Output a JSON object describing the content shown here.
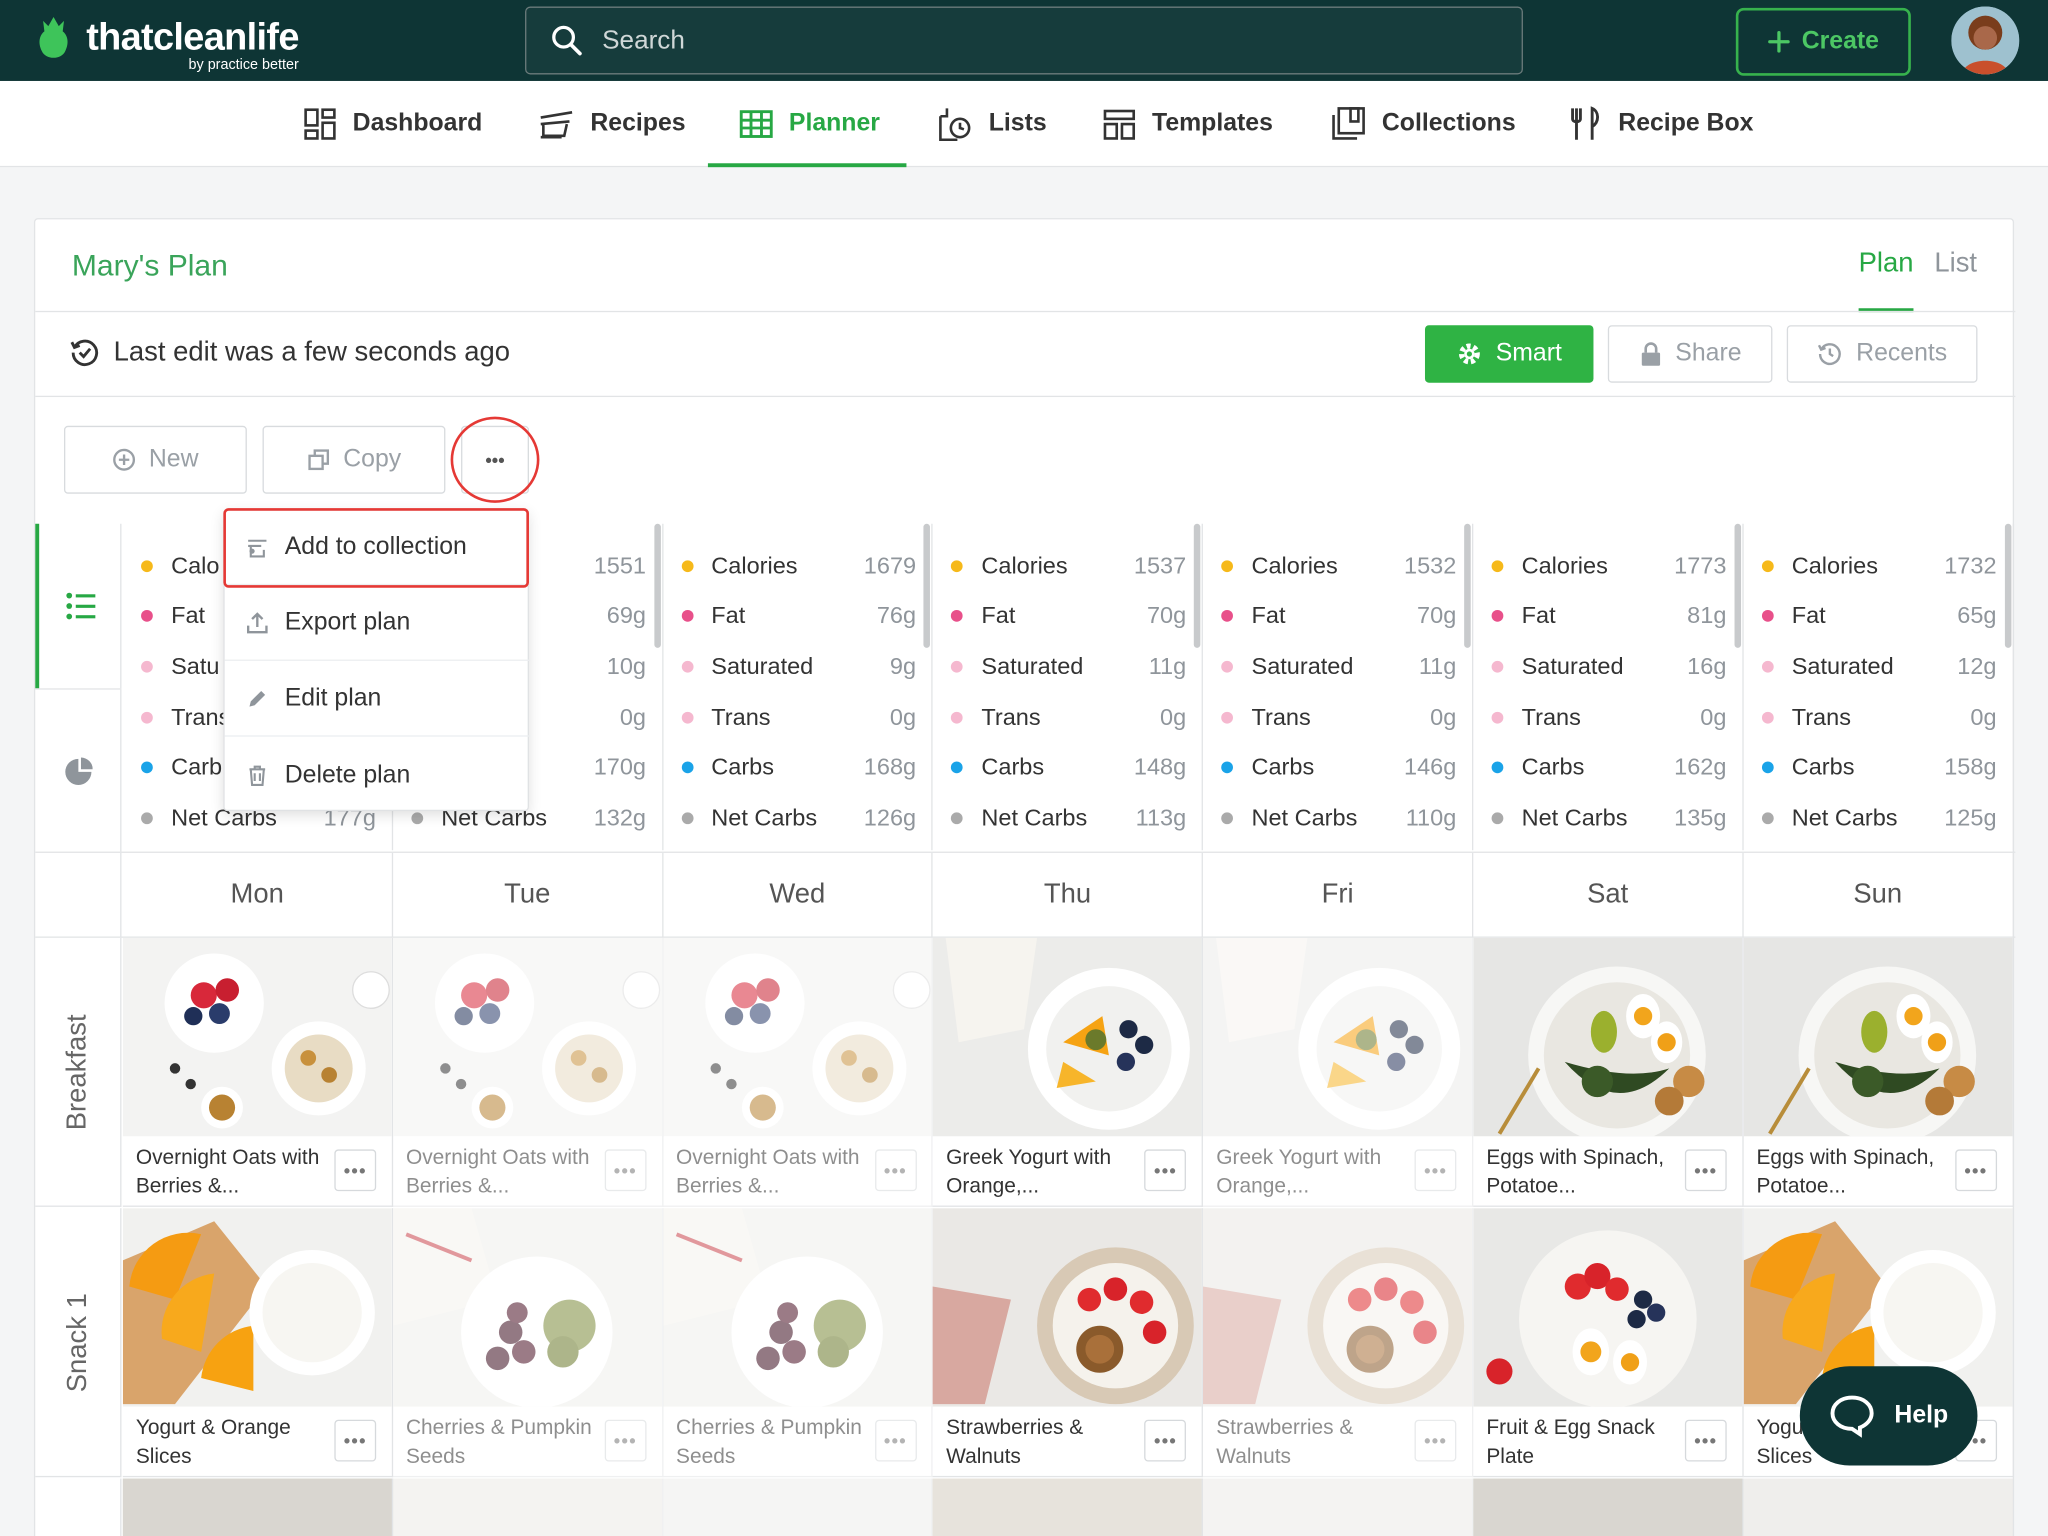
{
  "brand": {
    "name": "thatcleanlife",
    "sub": "by practice better"
  },
  "search": {
    "placeholder": "Search"
  },
  "create_label": "Create",
  "nav": [
    {
      "label": "Dashboard",
      "icon": "dashboard-icon"
    },
    {
      "label": "Recipes",
      "icon": "recipes-icon"
    },
    {
      "label": "Planner",
      "icon": "planner-icon",
      "active": true
    },
    {
      "label": "Lists",
      "icon": "lists-icon"
    },
    {
      "label": "Templates",
      "icon": "templates-icon"
    },
    {
      "label": "Collections",
      "icon": "collections-icon"
    },
    {
      "label": "Recipe Box",
      "icon": "recipe-box-icon"
    }
  ],
  "plan": {
    "title": "Mary's Plan",
    "tab_plan": "Plan",
    "tab_list": "List",
    "last_edit": "Last edit was a few seconds ago"
  },
  "actions": {
    "smart": "Smart",
    "share": "Share",
    "recents": "Recents",
    "new": "New",
    "copy": "Copy",
    "more": "•••"
  },
  "menu": [
    {
      "label": "Add to collection",
      "icon": "collection-add-icon"
    },
    {
      "label": "Export plan",
      "icon": "export-icon"
    },
    {
      "label": "Edit plan",
      "icon": "pencil-icon"
    },
    {
      "label": "Delete plan",
      "icon": "trash-icon"
    }
  ],
  "nutrient_names": [
    "Calories",
    "Fat",
    "Saturated",
    "Trans",
    "Carbs",
    "Net Carbs"
  ],
  "nutrient_colors": [
    "#f6b91a",
    "#e8508a",
    "#f5b8cf",
    "#f5b8cf",
    "#1aa3e8",
    "#aaaaaa"
  ],
  "nutrition": [
    {
      "day": "Mon",
      "values": [
        "",
        "",
        "",
        "",
        "",
        "177g"
      ],
      "labels": [
        "Calo",
        "Fat",
        "Satu",
        "Trans",
        "Carb",
        "Net Carbs"
      ]
    },
    {
      "day": "Tue",
      "values": [
        "1551",
        "69g",
        "10g",
        "0g",
        "170g",
        "132g"
      ],
      "labels": [
        "",
        "",
        "ed",
        "",
        "",
        "Net Carbs"
      ]
    },
    {
      "day": "Wed",
      "values": [
        "1679",
        "76g",
        "9g",
        "0g",
        "168g",
        "126g"
      ]
    },
    {
      "day": "Thu",
      "values": [
        "1537",
        "70g",
        "11g",
        "0g",
        "148g",
        "113g"
      ]
    },
    {
      "day": "Fri",
      "values": [
        "1532",
        "70g",
        "11g",
        "0g",
        "146g",
        "110g"
      ]
    },
    {
      "day": "Sat",
      "values": [
        "1773",
        "81g",
        "16g",
        "0g",
        "162g",
        "135g"
      ]
    },
    {
      "day": "Sun",
      "values": [
        "1732",
        "65g",
        "12g",
        "0g",
        "158g",
        "125g"
      ]
    }
  ],
  "days": [
    "Mon",
    "Tue",
    "Wed",
    "Thu",
    "Fri",
    "Sat",
    "Sun"
  ],
  "meal_types": [
    "Breakfast",
    "Snack 1"
  ],
  "meals": {
    "breakfast": [
      "Overnight Oats with Berries &...",
      "Overnight Oats with Berries &...",
      "Overnight Oats with Berries &...",
      "Greek Yogurt with Orange,...",
      "Greek Yogurt with Orange,...",
      "Eggs with Spinach, Potatoe...",
      "Eggs with Spinach, Potatoe..."
    ],
    "snack1": [
      "Yogurt & Orange Slices",
      "Cherries & Pumpkin Seeds",
      "Cherries & Pumpkin Seeds",
      "Strawberries & Walnuts",
      "Strawberries & Walnuts",
      "Fruit & Egg Snack Plate",
      "Yogurt & Orange Slices"
    ]
  },
  "help_label": "Help"
}
